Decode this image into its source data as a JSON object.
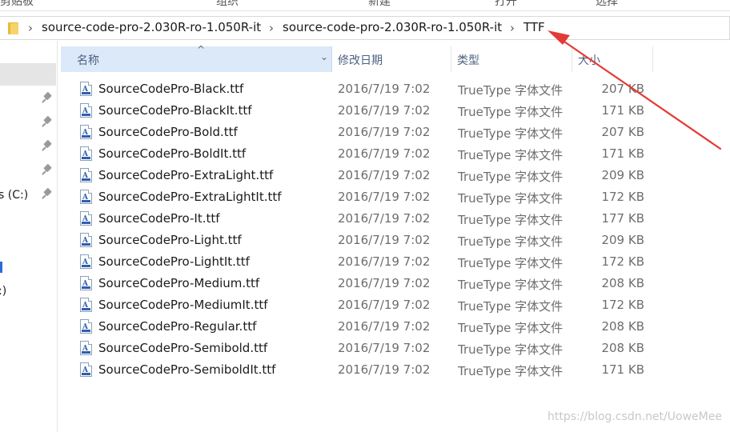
{
  "ribbon": {
    "groups": [
      "剪贴板",
      "组织",
      "新建",
      "打开",
      "选择"
    ]
  },
  "address": {
    "breadcrumbs": [
      "source-code-pro-2.030R-ro-1.050R-it",
      "source-code-pro-2.030R-ro-1.050R-it",
      "TTF"
    ],
    "separator": "›"
  },
  "nav": {
    "items": [
      "s (C:)",
      ":)"
    ]
  },
  "columns": {
    "name": "名称",
    "date": "修改日期",
    "type": "类型",
    "size": "大小"
  },
  "files": [
    {
      "name": "SourceCodePro-Black.ttf",
      "date": "2016/7/19 7:02",
      "type": "TrueType 字体文件",
      "size": "207 KB"
    },
    {
      "name": "SourceCodePro-BlackIt.ttf",
      "date": "2016/7/19 7:02",
      "type": "TrueType 字体文件",
      "size": "171 KB"
    },
    {
      "name": "SourceCodePro-Bold.ttf",
      "date": "2016/7/19 7:02",
      "type": "TrueType 字体文件",
      "size": "207 KB"
    },
    {
      "name": "SourceCodePro-BoldIt.ttf",
      "date": "2016/7/19 7:02",
      "type": "TrueType 字体文件",
      "size": "171 KB"
    },
    {
      "name": "SourceCodePro-ExtraLight.ttf",
      "date": "2016/7/19 7:02",
      "type": "TrueType 字体文件",
      "size": "209 KB"
    },
    {
      "name": "SourceCodePro-ExtraLightIt.ttf",
      "date": "2016/7/19 7:02",
      "type": "TrueType 字体文件",
      "size": "172 KB"
    },
    {
      "name": "SourceCodePro-It.ttf",
      "date": "2016/7/19 7:02",
      "type": "TrueType 字体文件",
      "size": "177 KB"
    },
    {
      "name": "SourceCodePro-Light.ttf",
      "date": "2016/7/19 7:02",
      "type": "TrueType 字体文件",
      "size": "209 KB"
    },
    {
      "name": "SourceCodePro-LightIt.ttf",
      "date": "2016/7/19 7:02",
      "type": "TrueType 字体文件",
      "size": "172 KB"
    },
    {
      "name": "SourceCodePro-Medium.ttf",
      "date": "2016/7/19 7:02",
      "type": "TrueType 字体文件",
      "size": "208 KB"
    },
    {
      "name": "SourceCodePro-MediumIt.ttf",
      "date": "2016/7/19 7:02",
      "type": "TrueType 字体文件",
      "size": "172 KB"
    },
    {
      "name": "SourceCodePro-Regular.ttf",
      "date": "2016/7/19 7:02",
      "type": "TrueType 字体文件",
      "size": "208 KB"
    },
    {
      "name": "SourceCodePro-Semibold.ttf",
      "date": "2016/7/19 7:02",
      "type": "TrueType 字体文件",
      "size": "208 KB"
    },
    {
      "name": "SourceCodePro-SemiboldIt.ttf",
      "date": "2016/7/19 7:02",
      "type": "TrueType 字体文件",
      "size": "171 KB"
    }
  ],
  "file_icon": "truetype-font-file-icon",
  "watermark": "https://blog.csdn.net/UoweMee",
  "colors": {
    "header_selected": "#dbe9f9",
    "header_text": "#4d6082",
    "annotation_arrow": "#e53935",
    "folder": "#f6d36b"
  }
}
